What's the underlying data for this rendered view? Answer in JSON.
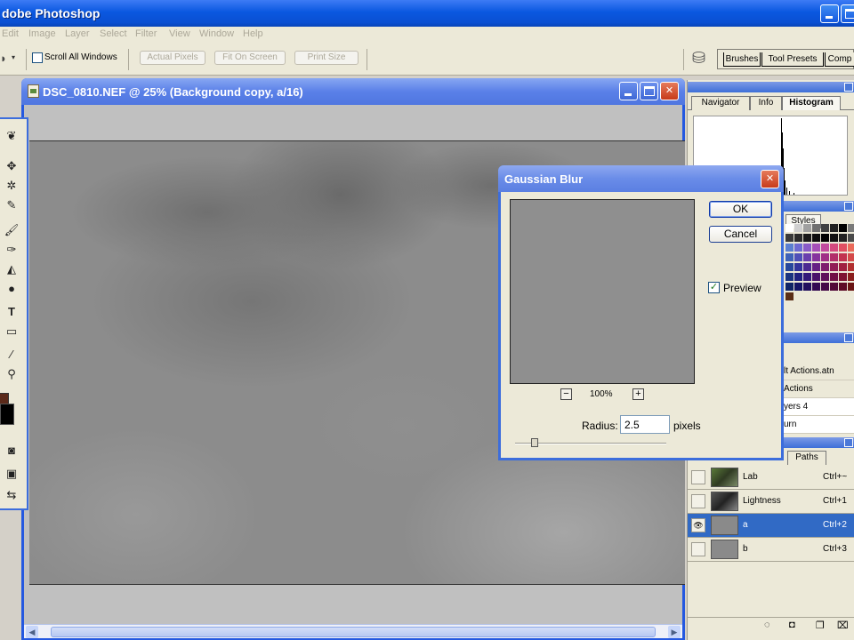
{
  "app": {
    "title": "dobe Photoshop"
  },
  "menu": [
    "Edit",
    "Image",
    "Layer",
    "Select",
    "Filter",
    "View",
    "Window",
    "Help"
  ],
  "options": {
    "scroll_all_windows": "Scroll All Windows",
    "actual_pixels": "Actual Pixels",
    "fit_on_screen": "Fit On Screen",
    "print_size": "Print Size"
  },
  "palette_well": {
    "tabs": [
      "Brushes",
      "Tool Presets",
      "Comp"
    ]
  },
  "document": {
    "title": "DSC_0810.NEF @ 25% (Background copy, a/16)"
  },
  "dialog": {
    "title": "Gaussian Blur",
    "ok": "OK",
    "cancel": "Cancel",
    "preview_label": "Preview",
    "preview_checked": true,
    "zoom_minus": "−",
    "zoom_plus": "+",
    "zoom": "100%",
    "radius_label": "Radius:",
    "radius_value": "2.5",
    "radius_unit": "pixels",
    "colors": {
      "accent": "#3c6ddc",
      "body": "#ece9d8"
    }
  },
  "panels": {
    "navigator_tabs": [
      "Navigator",
      "Info",
      "Histogram"
    ],
    "active_navigator_tab": "Histogram",
    "swatches_tab": "Styles",
    "actions": [
      "lt Actions.atn",
      "Actions",
      "yers 4",
      "urn"
    ],
    "layers_tab": "Paths",
    "channels": [
      {
        "name": "Lab",
        "shortcut": "Ctrl+~",
        "selected": false,
        "visible": false
      },
      {
        "name": "Lightness",
        "shortcut": "Ctrl+1",
        "selected": false,
        "visible": false
      },
      {
        "name": "a",
        "shortcut": "Ctrl+2",
        "selected": true,
        "visible": true
      },
      {
        "name": "b",
        "shortcut": "Ctrl+3",
        "selected": false,
        "visible": false
      }
    ]
  },
  "icons": {
    "eye": "👁",
    "check": "✓"
  }
}
